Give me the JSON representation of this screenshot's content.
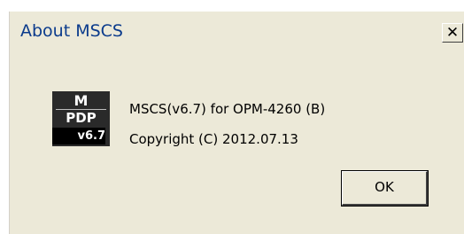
{
  "window": {
    "title": "About MSCS",
    "close_glyph": "✕",
    "close_icon": "close-icon"
  },
  "app_icon": {
    "name": "mscs-app-icon",
    "line1": "M",
    "line2": "PDP",
    "line3": "v6.7"
  },
  "message": {
    "line1": "MSCS(v6.7) for OPM-4260 (B)",
    "line2": "Copyright (C) 2012.07.13"
  },
  "buttons": {
    "ok_label": "OK"
  },
  "colors": {
    "dialog_bg": "#ece9d8",
    "title_text": "#0b3b8c",
    "icon_bg": "#2a2a2a"
  }
}
